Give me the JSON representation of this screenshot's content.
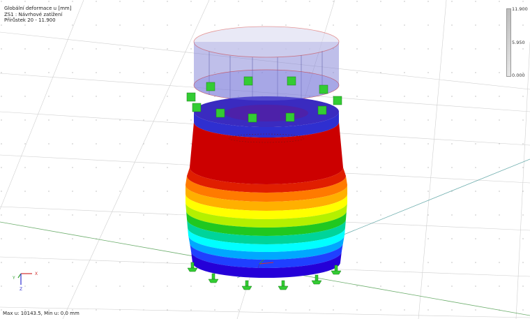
{
  "info": {
    "line1": "Globální deformace u [mm]",
    "line2": "ZS1 : Návrhové zatížení",
    "line3": "Přírůstek 20 - 11.900"
  },
  "scale": {
    "top": "11.900",
    "mid": "5.950",
    "bottom": "0.000"
  },
  "footer": {
    "text": "Max u: 10143.5, Min u: 0.0 mm"
  },
  "axes": {
    "x": "X",
    "y": "Y",
    "z": "Z"
  },
  "colors": {
    "band_top_to_bottom": [
      "#2f2fd0",
      "#cc0000",
      "#d40f00",
      "#e01e00",
      "#ff7a00",
      "#ffb000",
      "#ffff00",
      "#b4f000",
      "#20c820",
      "#00d49a",
      "#00ffff",
      "#00a8ff",
      "#1f40ff",
      "#2500d8"
    ],
    "ghost_cylinder": "#8a8ad8",
    "support_symbol": "#33cc33"
  }
}
